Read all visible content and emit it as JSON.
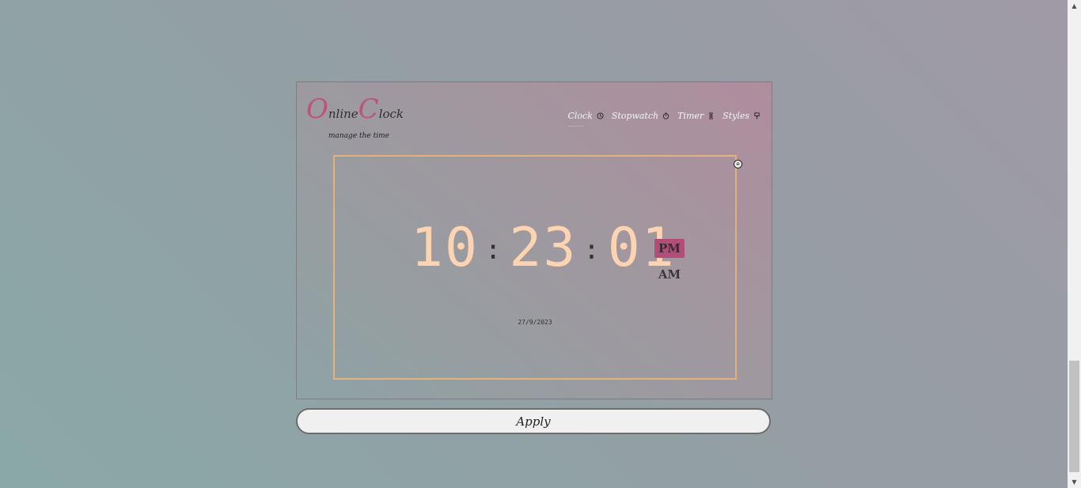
{
  "logo": {
    "first_initial": "O",
    "first_rest": "nline",
    "second_initial": "C",
    "second_rest": "lock"
  },
  "tagline": "manage the time",
  "nav": {
    "items": [
      {
        "label": "Clock",
        "icon": "clock-icon"
      },
      {
        "label": "Stopwatch",
        "icon": "stopwatch-icon"
      },
      {
        "label": "Timer",
        "icon": "hourglass-icon"
      },
      {
        "label": "Styles",
        "icon": "paint-brush-icon"
      }
    ],
    "active": "Clock"
  },
  "clock": {
    "hours": "10",
    "minutes": "23",
    "seconds": "01",
    "separator": ":",
    "pm_label": "PM",
    "am_label": "AM",
    "selected_period": "PM",
    "date": "27/9/2023"
  },
  "apply_label": "Apply",
  "colors": {
    "digits": "#fcd4b1",
    "accent": "#b14d79",
    "frame": "#e3b27c",
    "logo_initial": "#c0517a"
  }
}
